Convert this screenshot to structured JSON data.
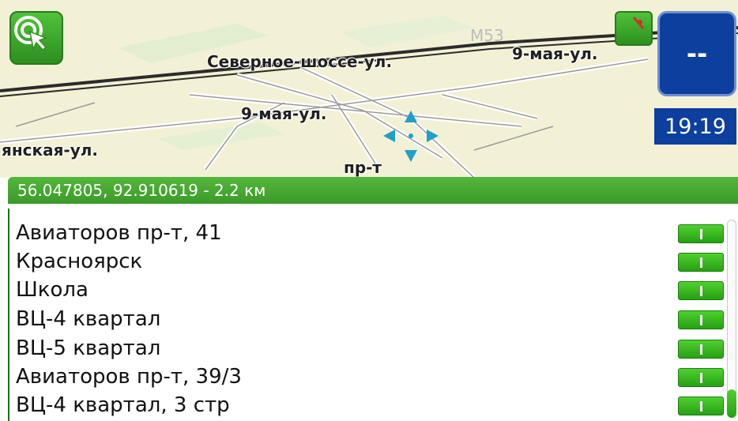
{
  "map": {
    "streets": {
      "severnoe": "Северное-шоссе-ул.",
      "m53": "М53",
      "may9_right": "9-мая-ул.",
      "may9_center": "9-мая-ул.",
      "yanskaya": "янская-ул.",
      "pr_t": "пр-т"
    }
  },
  "toolbar": {
    "target_icon": "target-cursor-icon",
    "gps_icon": "gps-status-icon"
  },
  "speed": {
    "value": "--"
  },
  "clock": {
    "time": "19:19"
  },
  "coords": {
    "text": "56.047805, 92.910619 - 2.2 км"
  },
  "results": [
    {
      "label": "Авиаторов пр-т, 41"
    },
    {
      "label": "Красноярск"
    },
    {
      "label": "Школа"
    },
    {
      "label": "ВЦ-4 квартал"
    },
    {
      "label": "ВЦ-5 квартал"
    },
    {
      "label": "Авиаторов пр-т, 39/3"
    },
    {
      "label": "ВЦ-4 квартал, 3 стр"
    }
  ],
  "colors": {
    "accent_green": "#3d9a2a",
    "speed_blue": "#0d3f9e"
  }
}
